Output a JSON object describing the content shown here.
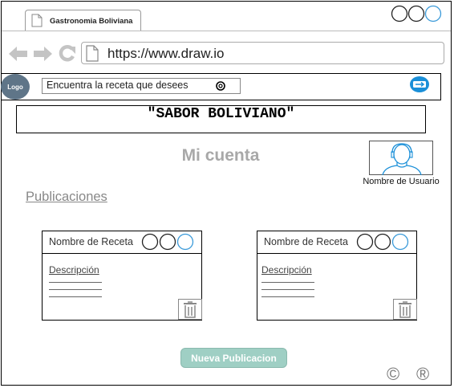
{
  "browser": {
    "tab_title": "Gastronomia Boliviana",
    "url": "https://www.draw.io"
  },
  "header": {
    "logo_label": "Logo",
    "search_placeholder": "Encuentra la receta que desees"
  },
  "banner": {
    "title": "\"SABOR BOLIVIANO\""
  },
  "page": {
    "heading": "Mi cuenta",
    "user_name": "Nombre de Usuario",
    "section_title": "Publicaciones"
  },
  "cards": [
    {
      "name": "Nombre de Receta",
      "description_label": "Descripción"
    },
    {
      "name": "Nombre de Receta",
      "description_label": "Descripción"
    }
  ],
  "actions": {
    "new_post_label": "Nueva Publicacion"
  },
  "footer": {
    "copyright_symbol": "©",
    "registered_symbol": "®"
  },
  "colors": {
    "logo_bg": "#5f7588",
    "button_bg": "#9fcfc4",
    "window_control_accent": "#3a9ad9",
    "heading_gray": "#a8a8a8",
    "icon_gray": "#c4c4c4"
  }
}
